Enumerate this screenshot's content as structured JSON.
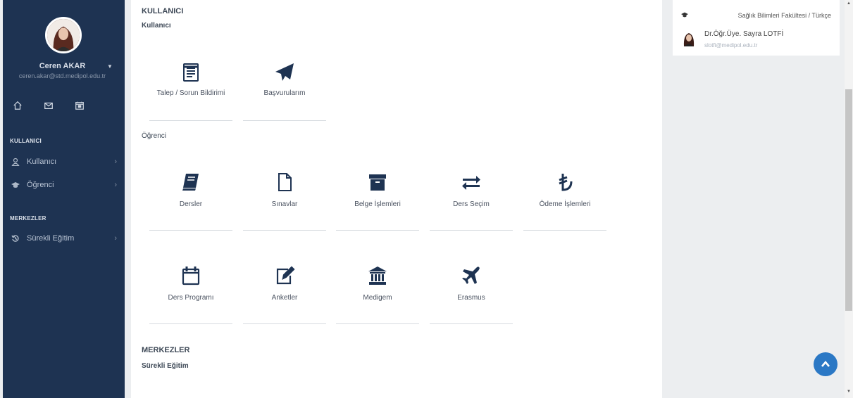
{
  "user": {
    "name": "Ceren AKAR",
    "email": "ceren.akar@std.medipol.edu.tr"
  },
  "sidebar": {
    "quick_icons": [
      "home-icon",
      "mail-icon",
      "calendar-icon"
    ],
    "section_user": "KULLANICI",
    "section_centers": "MERKEZLER",
    "items": [
      {
        "label": "Kullanıcı",
        "icon": "user-icon"
      },
      {
        "label": "Öğrenci",
        "icon": "graduation-cap-icon"
      },
      {
        "label": "Sürekli Eğitim",
        "icon": "history-icon"
      }
    ]
  },
  "main": {
    "section_user": "KULLANICI",
    "sub_user": "Kullanıcı",
    "sub_student": "Öğrenci",
    "section_centers": "MERKEZLER",
    "sub_continuing": "Sürekli Eğitim",
    "user_tiles": [
      {
        "label": "Talep / Sorun Bildirimi",
        "icon": "form-icon"
      },
      {
        "label": "Başvurularım",
        "icon": "paper-plane-icon"
      }
    ],
    "student_tiles": [
      {
        "label": "Dersler",
        "icon": "book-icon"
      },
      {
        "label": "Sınavlar",
        "icon": "file-icon"
      },
      {
        "label": "Belge İşlemleri",
        "icon": "archive-icon"
      },
      {
        "label": "Ders Seçim",
        "icon": "exchange-icon"
      },
      {
        "label": "Ödeme İşlemleri",
        "icon": "lira-icon"
      },
      {
        "label": "Ders Programı",
        "icon": "calendar-icon"
      },
      {
        "label": "Anketler",
        "icon": "edit-icon"
      },
      {
        "label": "Medigem",
        "icon": "institution-icon"
      },
      {
        "label": "Erasmus",
        "icon": "plane-icon"
      }
    ]
  },
  "info": {
    "faculty": "Sağlık Bilimleri Fakültesi / Türkçe",
    "advisor_name": "Dr.Öğr.Üye. Sayra LOTFİ",
    "advisor_email": "slotfi@medipol.edu.tr"
  },
  "colors": {
    "sidebar_bg": "#1e3352",
    "icon_color": "#1e3352",
    "accent_blue": "#2b78c5"
  }
}
